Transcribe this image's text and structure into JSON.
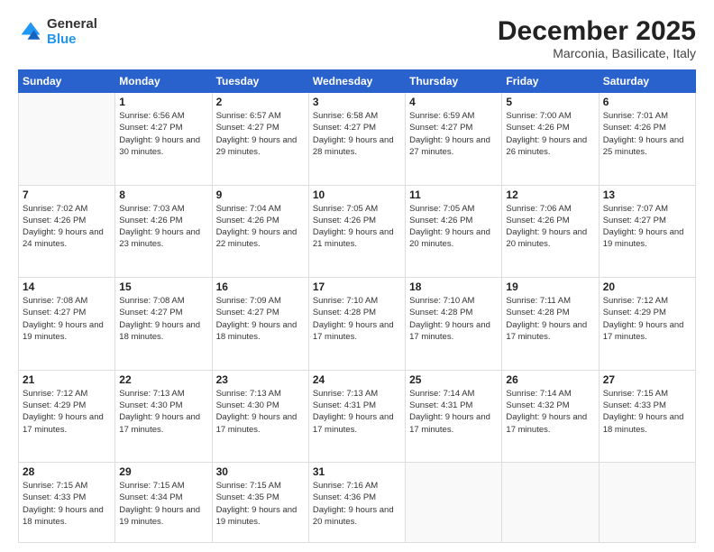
{
  "logo": {
    "general": "General",
    "blue": "Blue"
  },
  "header": {
    "month": "December 2025",
    "location": "Marconia, Basilicate, Italy"
  },
  "days_header": [
    "Sunday",
    "Monday",
    "Tuesday",
    "Wednesday",
    "Thursday",
    "Friday",
    "Saturday"
  ],
  "weeks": [
    [
      {
        "day": "",
        "sunrise": "",
        "sunset": "",
        "daylight": "",
        "empty": true
      },
      {
        "day": "1",
        "sunrise": "Sunrise: 6:56 AM",
        "sunset": "Sunset: 4:27 PM",
        "daylight": "Daylight: 9 hours and 30 minutes."
      },
      {
        "day": "2",
        "sunrise": "Sunrise: 6:57 AM",
        "sunset": "Sunset: 4:27 PM",
        "daylight": "Daylight: 9 hours and 29 minutes."
      },
      {
        "day": "3",
        "sunrise": "Sunrise: 6:58 AM",
        "sunset": "Sunset: 4:27 PM",
        "daylight": "Daylight: 9 hours and 28 minutes."
      },
      {
        "day": "4",
        "sunrise": "Sunrise: 6:59 AM",
        "sunset": "Sunset: 4:27 PM",
        "daylight": "Daylight: 9 hours and 27 minutes."
      },
      {
        "day": "5",
        "sunrise": "Sunrise: 7:00 AM",
        "sunset": "Sunset: 4:26 PM",
        "daylight": "Daylight: 9 hours and 26 minutes."
      },
      {
        "day": "6",
        "sunrise": "Sunrise: 7:01 AM",
        "sunset": "Sunset: 4:26 PM",
        "daylight": "Daylight: 9 hours and 25 minutes."
      }
    ],
    [
      {
        "day": "7",
        "sunrise": "Sunrise: 7:02 AM",
        "sunset": "Sunset: 4:26 PM",
        "daylight": "Daylight: 9 hours and 24 minutes."
      },
      {
        "day": "8",
        "sunrise": "Sunrise: 7:03 AM",
        "sunset": "Sunset: 4:26 PM",
        "daylight": "Daylight: 9 hours and 23 minutes."
      },
      {
        "day": "9",
        "sunrise": "Sunrise: 7:04 AM",
        "sunset": "Sunset: 4:26 PM",
        "daylight": "Daylight: 9 hours and 22 minutes."
      },
      {
        "day": "10",
        "sunrise": "Sunrise: 7:05 AM",
        "sunset": "Sunset: 4:26 PM",
        "daylight": "Daylight: 9 hours and 21 minutes."
      },
      {
        "day": "11",
        "sunrise": "Sunrise: 7:05 AM",
        "sunset": "Sunset: 4:26 PM",
        "daylight": "Daylight: 9 hours and 20 minutes."
      },
      {
        "day": "12",
        "sunrise": "Sunrise: 7:06 AM",
        "sunset": "Sunset: 4:26 PM",
        "daylight": "Daylight: 9 hours and 20 minutes."
      },
      {
        "day": "13",
        "sunrise": "Sunrise: 7:07 AM",
        "sunset": "Sunset: 4:27 PM",
        "daylight": "Daylight: 9 hours and 19 minutes."
      }
    ],
    [
      {
        "day": "14",
        "sunrise": "Sunrise: 7:08 AM",
        "sunset": "Sunset: 4:27 PM",
        "daylight": "Daylight: 9 hours and 19 minutes."
      },
      {
        "day": "15",
        "sunrise": "Sunrise: 7:08 AM",
        "sunset": "Sunset: 4:27 PM",
        "daylight": "Daylight: 9 hours and 18 minutes."
      },
      {
        "day": "16",
        "sunrise": "Sunrise: 7:09 AM",
        "sunset": "Sunset: 4:27 PM",
        "daylight": "Daylight: 9 hours and 18 minutes."
      },
      {
        "day": "17",
        "sunrise": "Sunrise: 7:10 AM",
        "sunset": "Sunset: 4:28 PM",
        "daylight": "Daylight: 9 hours and 17 minutes."
      },
      {
        "day": "18",
        "sunrise": "Sunrise: 7:10 AM",
        "sunset": "Sunset: 4:28 PM",
        "daylight": "Daylight: 9 hours and 17 minutes."
      },
      {
        "day": "19",
        "sunrise": "Sunrise: 7:11 AM",
        "sunset": "Sunset: 4:28 PM",
        "daylight": "Daylight: 9 hours and 17 minutes."
      },
      {
        "day": "20",
        "sunrise": "Sunrise: 7:12 AM",
        "sunset": "Sunset: 4:29 PM",
        "daylight": "Daylight: 9 hours and 17 minutes."
      }
    ],
    [
      {
        "day": "21",
        "sunrise": "Sunrise: 7:12 AM",
        "sunset": "Sunset: 4:29 PM",
        "daylight": "Daylight: 9 hours and 17 minutes."
      },
      {
        "day": "22",
        "sunrise": "Sunrise: 7:13 AM",
        "sunset": "Sunset: 4:30 PM",
        "daylight": "Daylight: 9 hours and 17 minutes."
      },
      {
        "day": "23",
        "sunrise": "Sunrise: 7:13 AM",
        "sunset": "Sunset: 4:30 PM",
        "daylight": "Daylight: 9 hours and 17 minutes."
      },
      {
        "day": "24",
        "sunrise": "Sunrise: 7:13 AM",
        "sunset": "Sunset: 4:31 PM",
        "daylight": "Daylight: 9 hours and 17 minutes."
      },
      {
        "day": "25",
        "sunrise": "Sunrise: 7:14 AM",
        "sunset": "Sunset: 4:31 PM",
        "daylight": "Daylight: 9 hours and 17 minutes."
      },
      {
        "day": "26",
        "sunrise": "Sunrise: 7:14 AM",
        "sunset": "Sunset: 4:32 PM",
        "daylight": "Daylight: 9 hours and 17 minutes."
      },
      {
        "day": "27",
        "sunrise": "Sunrise: 7:15 AM",
        "sunset": "Sunset: 4:33 PM",
        "daylight": "Daylight: 9 hours and 18 minutes."
      }
    ],
    [
      {
        "day": "28",
        "sunrise": "Sunrise: 7:15 AM",
        "sunset": "Sunset: 4:33 PM",
        "daylight": "Daylight: 9 hours and 18 minutes."
      },
      {
        "day": "29",
        "sunrise": "Sunrise: 7:15 AM",
        "sunset": "Sunset: 4:34 PM",
        "daylight": "Daylight: 9 hours and 19 minutes."
      },
      {
        "day": "30",
        "sunrise": "Sunrise: 7:15 AM",
        "sunset": "Sunset: 4:35 PM",
        "daylight": "Daylight: 9 hours and 19 minutes."
      },
      {
        "day": "31",
        "sunrise": "Sunrise: 7:16 AM",
        "sunset": "Sunset: 4:36 PM",
        "daylight": "Daylight: 9 hours and 20 minutes."
      },
      {
        "day": "",
        "sunrise": "",
        "sunset": "",
        "daylight": "",
        "empty": true
      },
      {
        "day": "",
        "sunrise": "",
        "sunset": "",
        "daylight": "",
        "empty": true
      },
      {
        "day": "",
        "sunrise": "",
        "sunset": "",
        "daylight": "",
        "empty": true
      }
    ]
  ]
}
